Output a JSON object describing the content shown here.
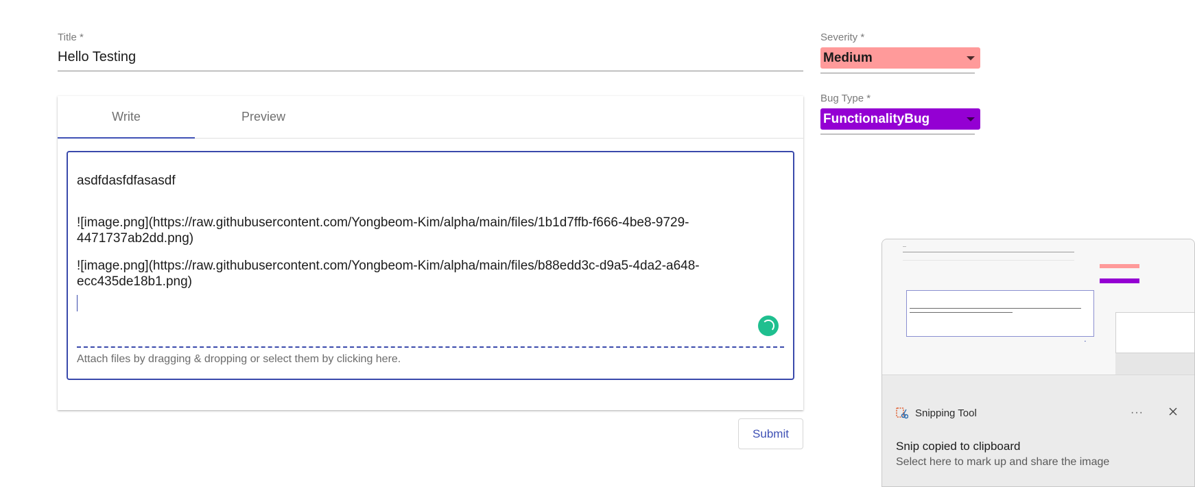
{
  "form": {
    "title_label": "Title *",
    "title_value": "Hello Testing",
    "tabs": [
      {
        "label": "Write",
        "active": true
      },
      {
        "label": "Preview",
        "active": false
      }
    ],
    "editor_lines": [
      "asdfdasfdfasasdf",
      "![image.png](https://raw.githubusercontent.com/Yongbeom-Kim/alpha/main/files/1b1d7ffb-f666-4be8-9729-4471737ab2dd.png)",
      "![image.png](https://raw.githubusercontent.com/Yongbeom-Kim/alpha/main/files/b88edd3c-d9a5-4da2-a648-ecc435de18b1.png)"
    ],
    "attach_hint": "Attach files by dragging & dropping or select them by clicking here.",
    "submit_label": "Submit"
  },
  "sidebar": {
    "severity_label": "Severity *",
    "severity_value": "Medium",
    "severity_color": "#ff9a9a",
    "bug_type_label": "Bug Type *",
    "bug_type_value": "FunctionalityBug",
    "bug_type_color": "#9400d3"
  },
  "toast": {
    "app_name": "Snipping Tool",
    "more_label": "···",
    "title": "Snip copied to clipboard",
    "subtitle": "Select here to mark up and share the image",
    "app_icon": "scissors-icon",
    "close_icon": "close-icon"
  },
  "colors": {
    "accent": "#3f51b5",
    "spinner": "#1fbf8f"
  }
}
